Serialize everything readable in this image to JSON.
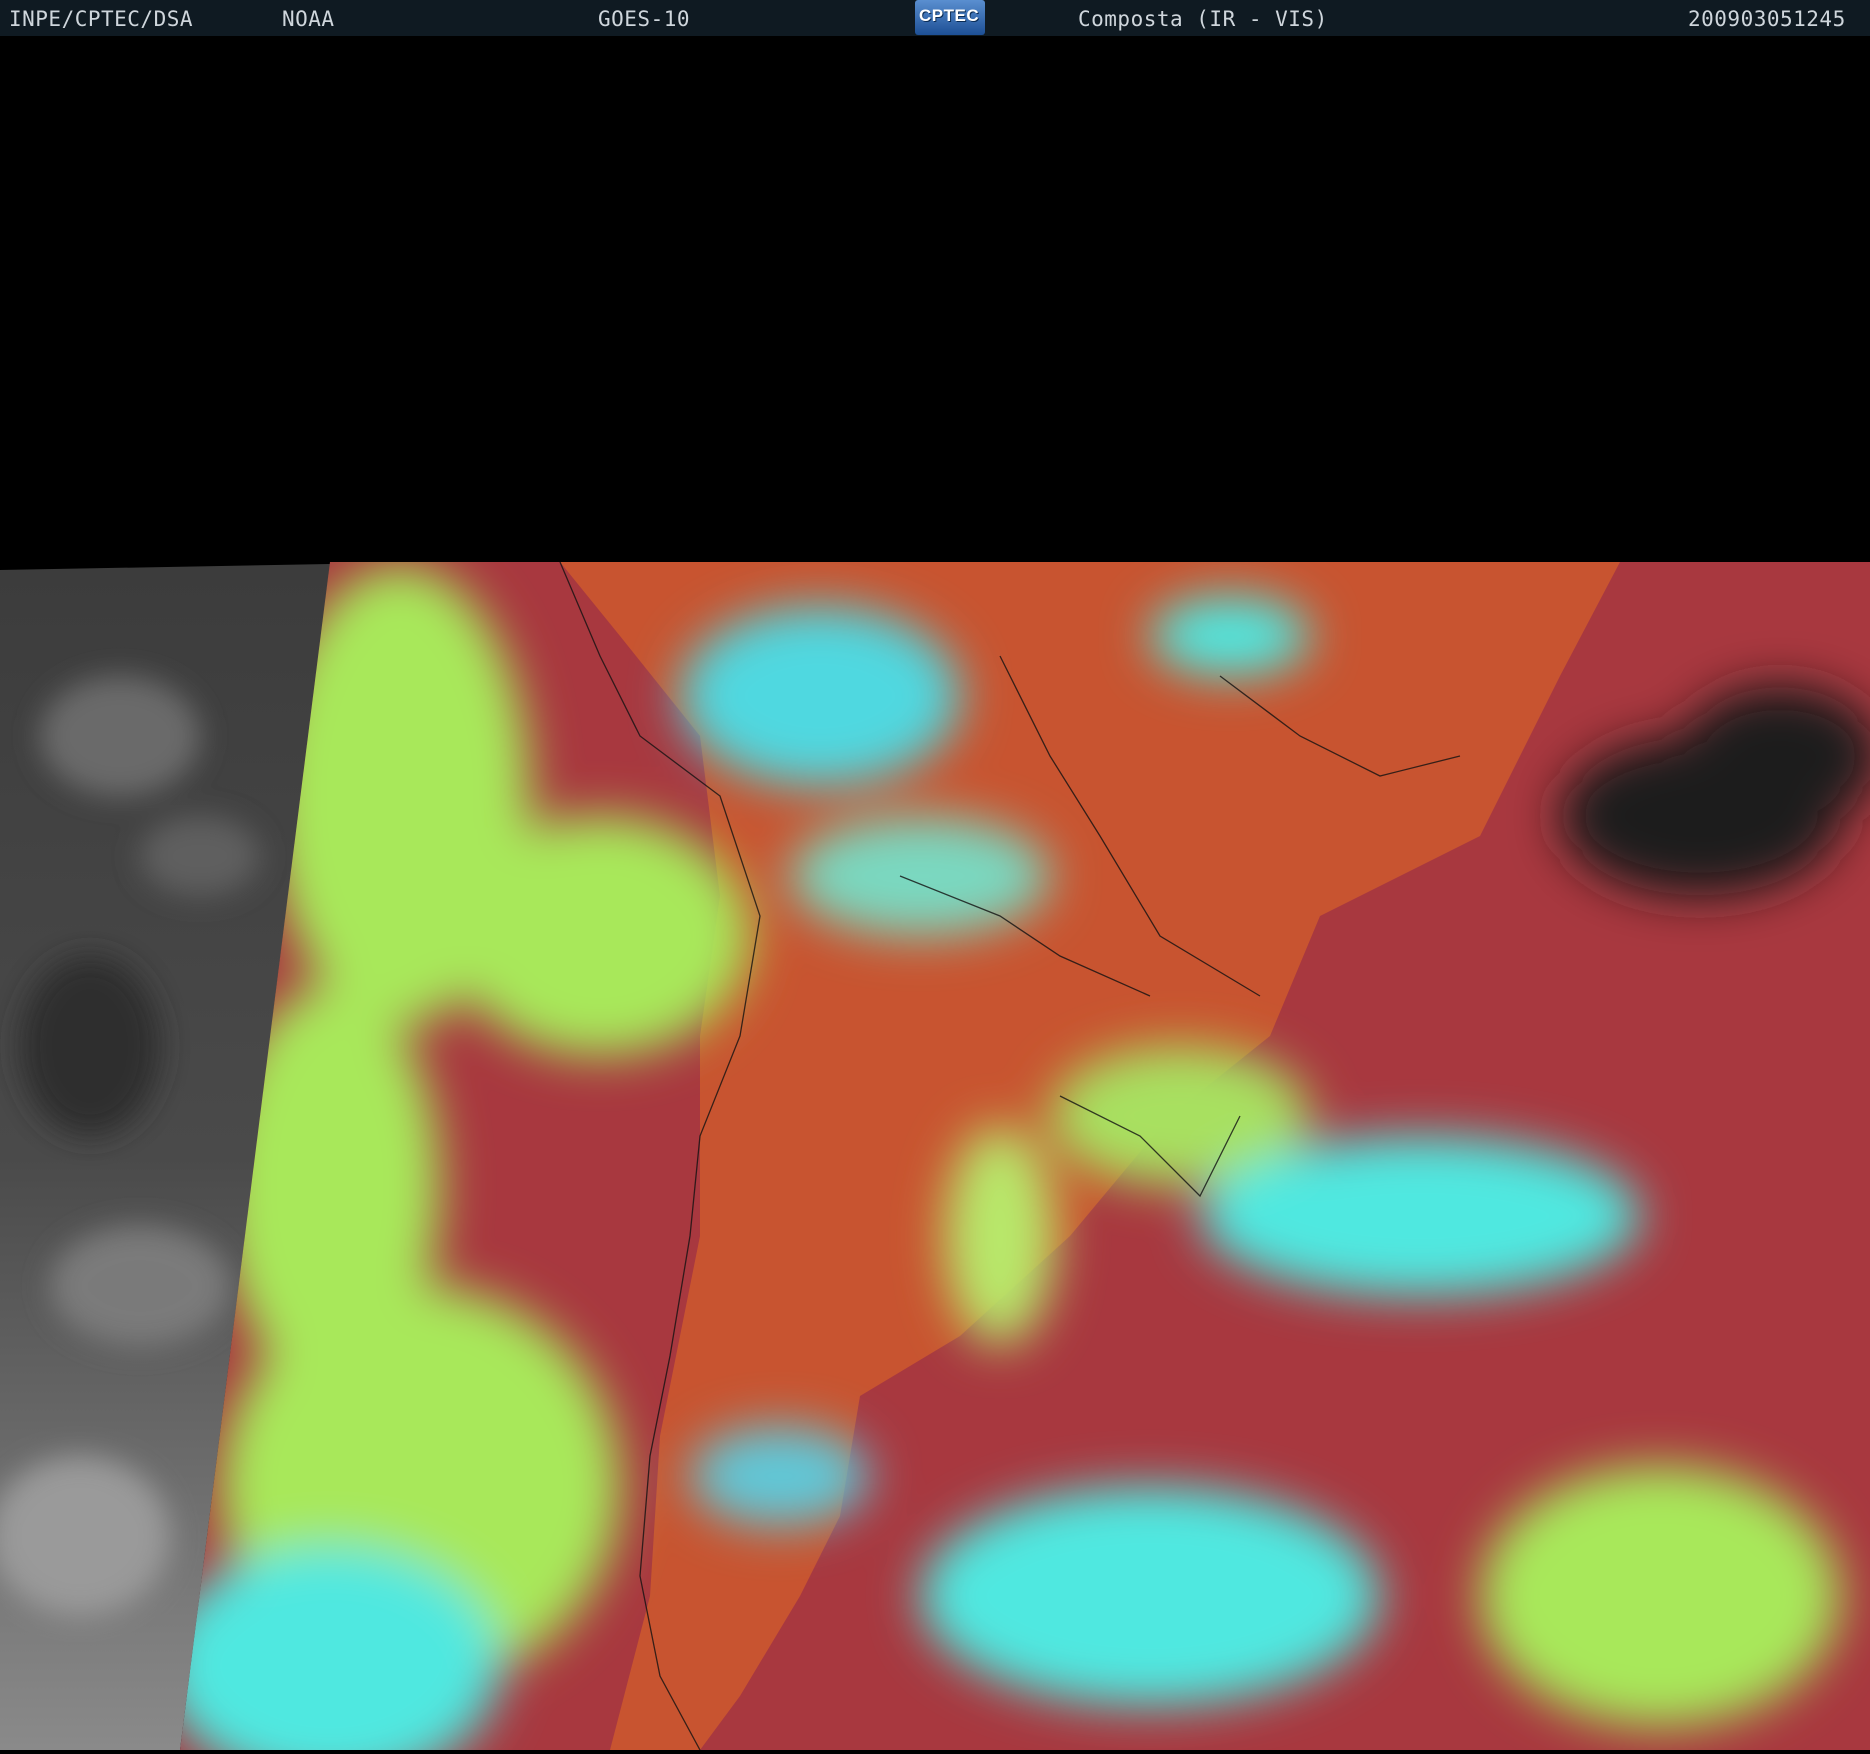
{
  "header": {
    "agency": "INPE/CPTEC/DSA",
    "source": "NOAA",
    "satellite": "GOES-10",
    "logo_text": "CPTEC",
    "product": "Composta (IR - VIS)",
    "timestamp": "200903051245"
  },
  "colors": {
    "header_bg": "#0f1a22",
    "space": "#000000",
    "land_warm": "#c85430",
    "ocean_warm": "#a8383f",
    "low_cloud": "#a8e85a",
    "high_cloud": "#4fe8e0",
    "night_side_gray": "#4a4a4a",
    "clear_night_ocean": "#1e1e1e"
  }
}
